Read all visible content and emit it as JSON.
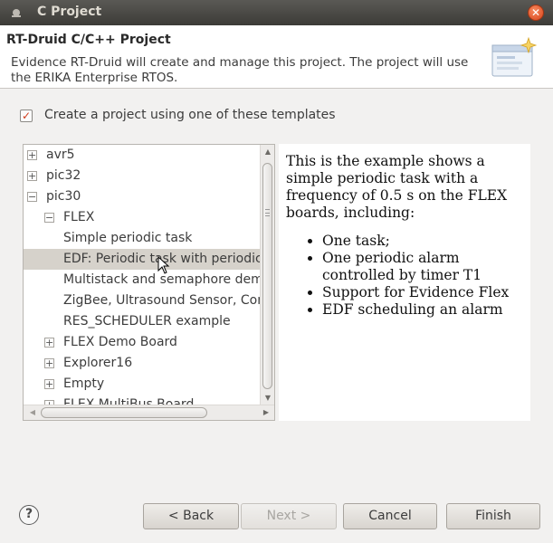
{
  "window": {
    "title": "C Project"
  },
  "header": {
    "title": "RT-Druid C/C++ Project",
    "description": "Evidence RT-Druid will create and manage this project. The project will use the ERIKA Enterprise RTOS."
  },
  "template_option": {
    "label": "Create a project using one of these templates",
    "checked": true
  },
  "tree": {
    "rows": [
      {
        "label": "avr5",
        "expander": "+"
      },
      {
        "label": "pic32",
        "expander": "+"
      },
      {
        "label": "pic30",
        "expander": "−"
      },
      {
        "label": "FLEX",
        "expander": "−"
      },
      {
        "label": "Simple periodic task",
        "expander": ""
      },
      {
        "label": "EDF: Periodic task with periodic alarm",
        "expander": "",
        "selected": true
      },
      {
        "label": "Multistack and semaphore demo",
        "expander": ""
      },
      {
        "label": "ZigBee, Ultrasound Sensor, Compass",
        "expander": ""
      },
      {
        "label": "RES_SCHEDULER example",
        "expander": ""
      },
      {
        "label": "FLEX Demo Board",
        "expander": "+"
      },
      {
        "label": "Explorer16",
        "expander": "+"
      },
      {
        "label": "Empty",
        "expander": "+"
      },
      {
        "label": "FLEX MultiBus Board",
        "expander": "+"
      }
    ]
  },
  "description_panel": {
    "intro": "This is the example shows a simple periodic task with a frequency of 0.5 s on the FLEX boards, including:",
    "bullets": [
      "One task;",
      "One periodic alarm controlled by timer T1",
      "Support for Evidence Flex",
      "EDF scheduling an alarm"
    ]
  },
  "buttons": {
    "help": "?",
    "back": "< Back",
    "next": "Next >",
    "cancel": "Cancel",
    "finish": "Finish"
  },
  "icons": {
    "close": "close-icon",
    "wizard": "wizard-banner-icon",
    "help": "help-icon"
  }
}
